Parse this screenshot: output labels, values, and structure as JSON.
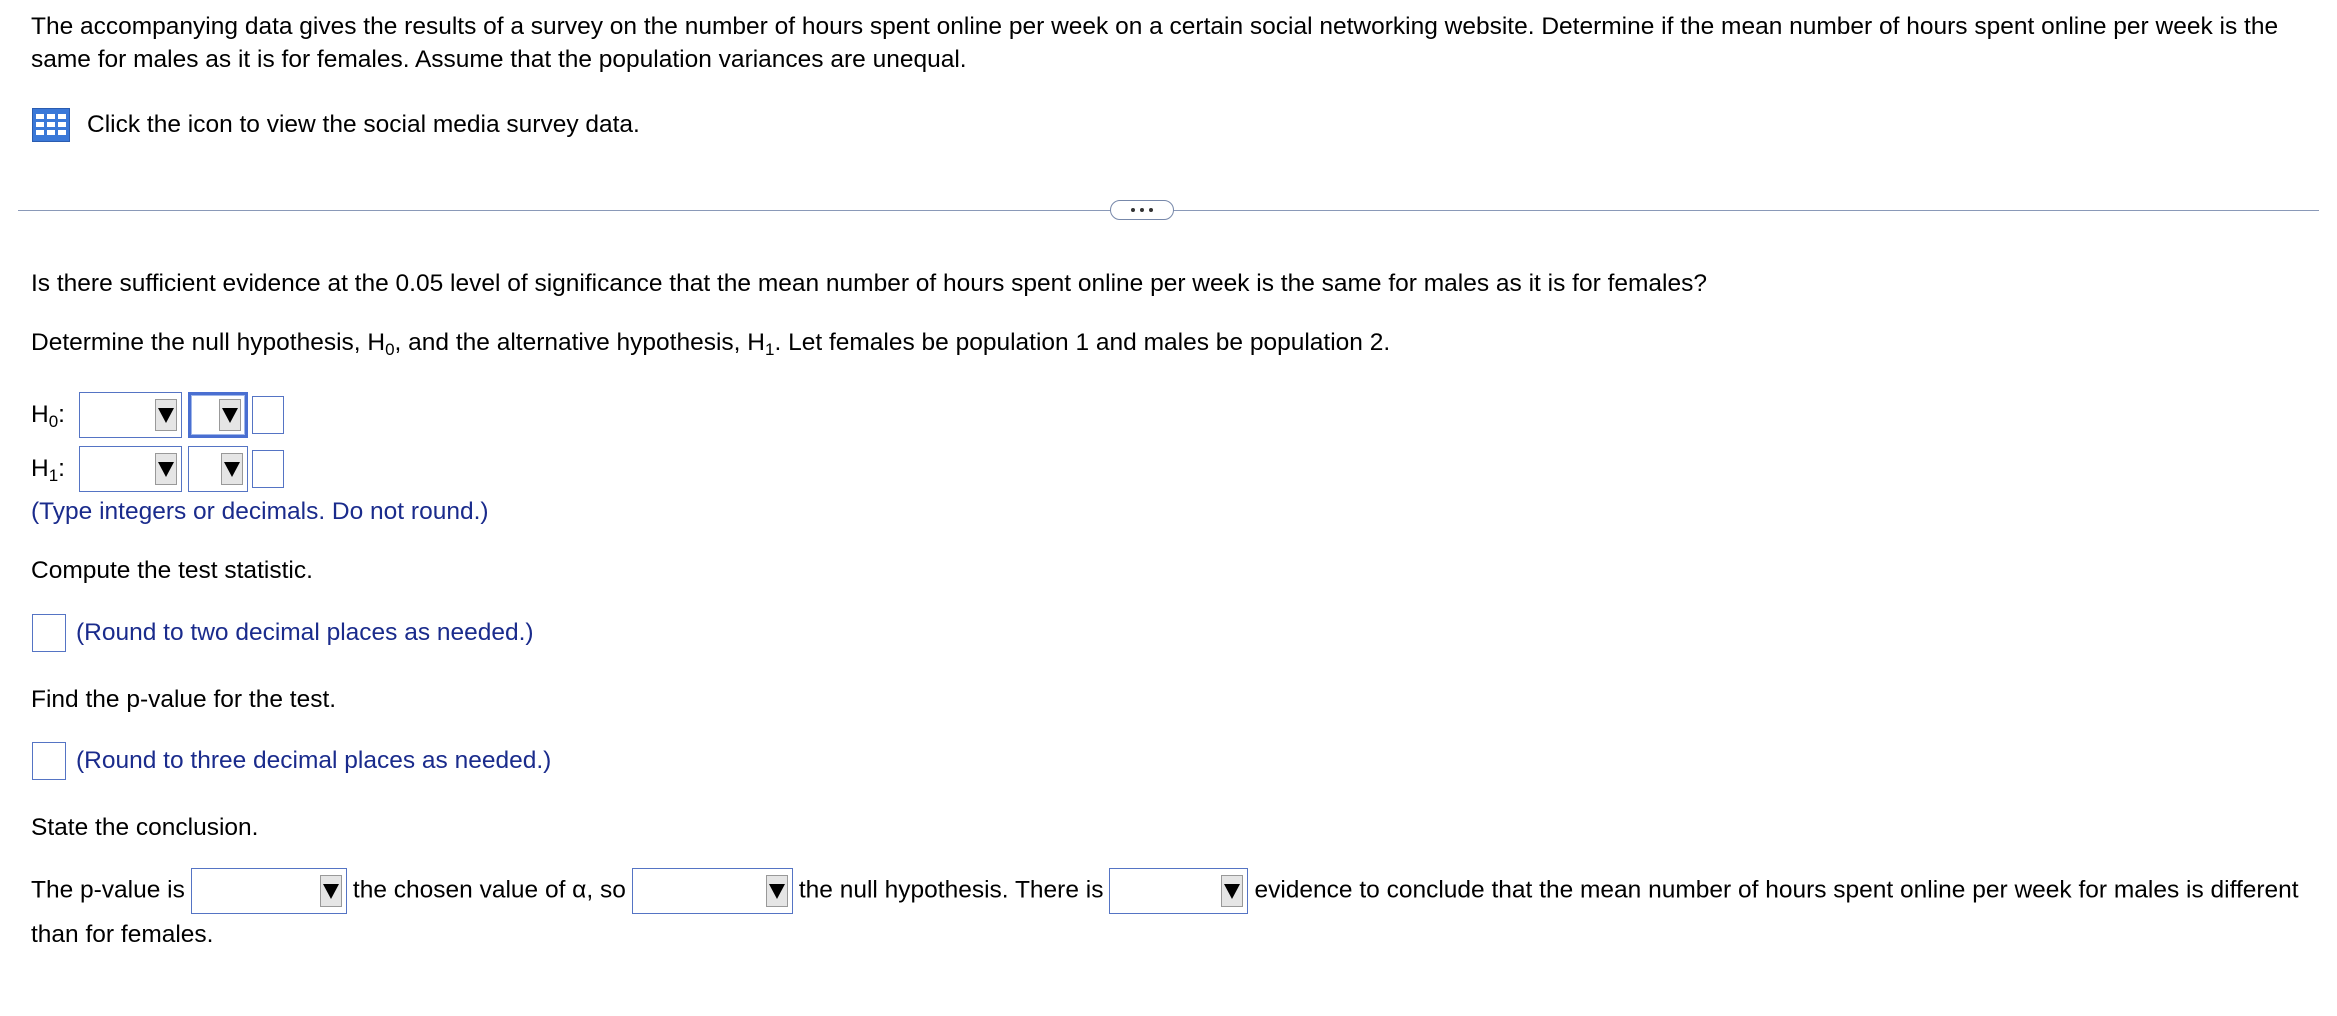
{
  "intro": {
    "text": "The accompanying data gives the results of a survey on the number of hours spent online per week on a certain social networking website. Determine if the mean number of hours spent online per week is the same for males as it is for females. Assume that the population variances are unequal."
  },
  "data_link": {
    "label": "Click the icon to view the social media survey data.",
    "icon": "grid-icon"
  },
  "question": {
    "main": "Is there sufficient evidence at the 0.05 level of significance that the mean number of hours spent online per week is the same for males as it is for females?",
    "hyp_prefix": "Determine the null hypothesis, H",
    "hyp_sub0": "0",
    "hyp_mid": ", and the alternative hypothesis, H",
    "hyp_sub1": "1",
    "hyp_suffix": ". Let females be population 1 and males be population 2."
  },
  "hypotheses": {
    "h0_letter": "H",
    "h0_sub": "0",
    "h0_colon": ":",
    "h1_letter": "H",
    "h1_sub": "1",
    "h1_colon": ":",
    "hint": "(Type integers or decimals. Do not round.)"
  },
  "test_statistic": {
    "prompt": "Compute the test statistic.",
    "hint": "(Round to two decimal places as needed.)"
  },
  "p_value": {
    "prompt": "Find the p-value for the test.",
    "hint": "(Round to three decimal places as needed.)"
  },
  "conclusion": {
    "prompt": "State the conclusion.",
    "part1": "The p-value is",
    "part2": "the chosen value of α, so",
    "part3": "the null hypothesis. There is",
    "part4": "evidence to conclude that the mean number of hours spent online per week for males is different than for females."
  },
  "colors": {
    "hint": "#1a2b8c",
    "input_border": "#5574c4",
    "divider": "#8a99b8"
  }
}
